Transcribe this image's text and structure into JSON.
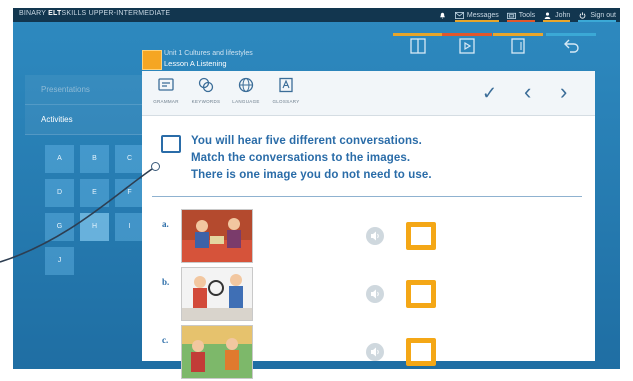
{
  "topbar": {
    "brand_prefix": "BINARY",
    "brand_bold": "ELT",
    "brand_rest": "SKILLS UPPER-INTERMEDIATE",
    "nav": [
      {
        "label": "",
        "icon": "bell-icon"
      },
      {
        "label": "Messages",
        "icon": "envelope-icon",
        "color": "#e6a52a"
      },
      {
        "label": "Tools",
        "icon": "toolbox-icon",
        "color": "#e1572c"
      },
      {
        "label": "John",
        "icon": "user-icon",
        "color": "#e8a62b"
      },
      {
        "label": "Sign out",
        "icon": "power-icon",
        "color": "#3ba9d6"
      }
    ]
  },
  "lesson": {
    "unit": "Unit 1 Cultures and lifestyles",
    "title": "Lesson A Listening"
  },
  "header_tools": [
    {
      "icon": "book-icon",
      "color": "#e6a52a"
    },
    {
      "icon": "video-icon",
      "color": "#e1572c"
    },
    {
      "icon": "document-icon",
      "color": "#e8a62b"
    },
    {
      "icon": "undo-icon",
      "color": "#3ba9d6"
    }
  ],
  "sidebar": {
    "items": [
      {
        "label": "Presentations"
      },
      {
        "label": "Activities"
      }
    ],
    "grid": [
      "A",
      "B",
      "C",
      "D",
      "E",
      "F",
      "G",
      "H",
      "I",
      "J"
    ]
  },
  "toolbar": {
    "buttons": [
      {
        "label": "GRAMMAR",
        "icon": "grammar-icon"
      },
      {
        "label": "KEYWORDS",
        "icon": "keywords-icon"
      },
      {
        "label": "LANGUAGE",
        "icon": "globe-icon"
      },
      {
        "label": "GLOSSARY",
        "icon": "glossary-icon"
      }
    ],
    "check": "✓",
    "prev": "‹",
    "next": "›"
  },
  "instructions": {
    "line1": "You will hear five different conversations.",
    "line2": "Match the conversations to the images.",
    "line3": "There is one image you do not need to use."
  },
  "rows": [
    {
      "letter": "a."
    },
    {
      "letter": "b."
    },
    {
      "letter": "c."
    }
  ],
  "colors": {
    "accent_orange": "#f4a716",
    "instruction_blue": "#2a6ca8",
    "topbar": "#12364f"
  }
}
